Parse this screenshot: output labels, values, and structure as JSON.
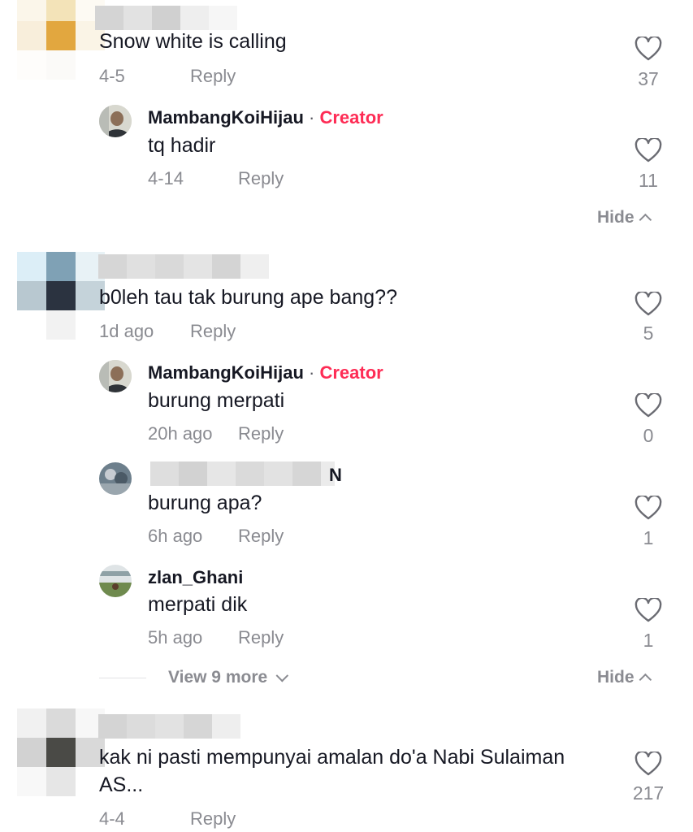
{
  "comments": [
    {
      "text": "Snow white is calling",
      "time": "4-5",
      "reply_label": "Reply",
      "likes": "37",
      "replies": [
        {
          "username": "MambangKoiHijau",
          "separator": "·",
          "badge": "Creator",
          "text": "tq hadir",
          "time": "4-14",
          "reply_label": "Reply",
          "likes": "11"
        }
      ],
      "hide_label": "Hide"
    },
    {
      "text": "b0leh tau tak burung ape bang??",
      "time": "1d ago",
      "reply_label": "Reply",
      "likes": "5",
      "replies": [
        {
          "username": "MambangKoiHijau",
          "separator": "·",
          "badge": "Creator",
          "text": "burung merpati",
          "time": "20h ago",
          "reply_label": "Reply",
          "likes": "0"
        },
        {
          "username_suffix": "N",
          "text": "burung apa?",
          "time": "6h ago",
          "reply_label": "Reply",
          "likes": "1"
        },
        {
          "username": "zlan_Ghani",
          "text": "merpati dik",
          "time": "5h ago",
          "reply_label": "Reply",
          "likes": "1"
        }
      ],
      "view_more_label": "View 9 more",
      "hide_label": "Hide"
    },
    {
      "text_line1": "kak ni pasti mempunyai amalan do'a Nabi Sulaiman",
      "text_line2": "AS...",
      "time": "4-4",
      "reply_label": "Reply",
      "likes": "217"
    }
  ],
  "colors": {
    "creator_badge": "#fe2c55",
    "secondary_text": "#8a8b91",
    "primary_text": "#161823"
  }
}
